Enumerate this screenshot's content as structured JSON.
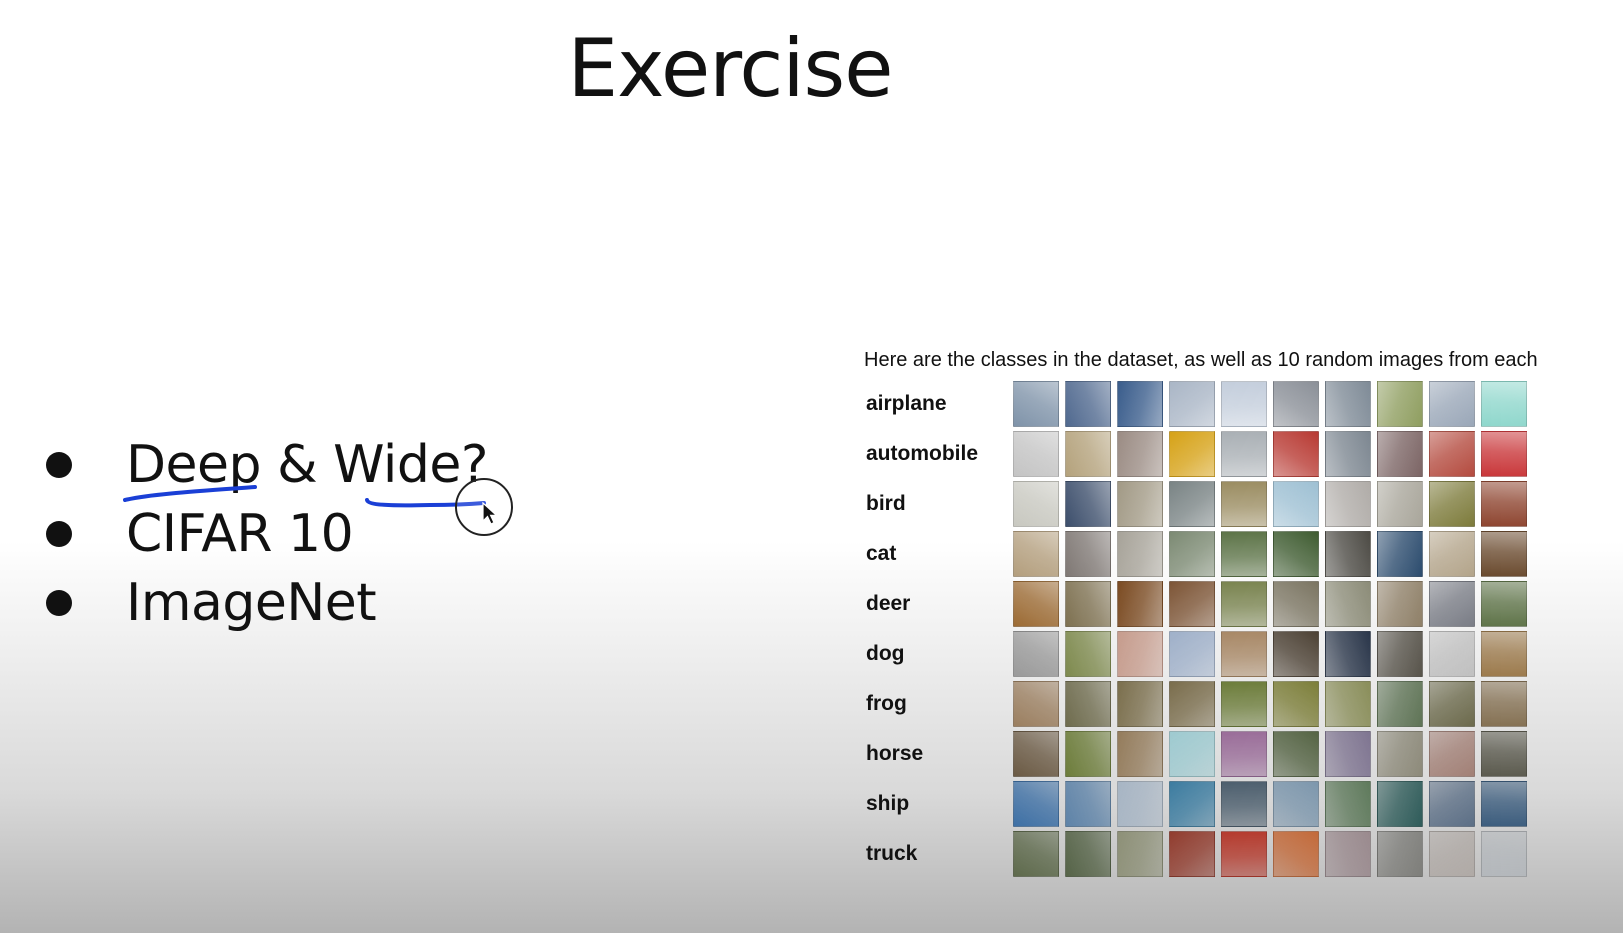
{
  "slide": {
    "title": "Exercise",
    "bullets": [
      {
        "text": "Deep & Wide?"
      },
      {
        "text": "CIFAR 10"
      },
      {
        "text": "ImageNet"
      }
    ]
  },
  "dataset": {
    "caption": "Here are the classes in the dataset, as well as 10 random images from each",
    "classes": [
      {
        "label": "airplane",
        "colors": [
          "#7f93a9",
          "#50698f",
          "#3a5d8c",
          "#aab6c6",
          "#c4cedc",
          "#8b9098",
          "#7f8b97",
          "#8f9e60",
          "#9aa7b8",
          "#8fd7cc"
        ]
      },
      {
        "label": "automobile",
        "colors": [
          "#c4c4c4",
          "#b4a27c",
          "#9b8c84",
          "#d6a217",
          "#aab0b5",
          "#b83a33",
          "#7d8791",
          "#7c6565",
          "#b44b3f",
          "#c9373a"
        ]
      },
      {
        "label": "bird",
        "colors": [
          "#c8c8c0",
          "#3d4f6c",
          "#a29a86",
          "#7a8485",
          "#9b8d62",
          "#9ec0d3",
          "#b0aca8",
          "#a9a69b",
          "#7d7b3b",
          "#8e4530"
        ]
      },
      {
        "label": "cat",
        "colors": [
          "#b39e7d",
          "#7f7874",
          "#a7a399",
          "#7c8a73",
          "#5d7448",
          "#3f5c31",
          "#4d4b45",
          "#2c4c6e",
          "#b3a48a",
          "#6a4a2e"
        ]
      },
      {
        "label": "deer",
        "colors": [
          "#9c6b34",
          "#7e7151",
          "#7b4b22",
          "#7d5536",
          "#7a8450",
          "#7b7562",
          "#8c8c78",
          "#8f8068",
          "#7a7d86",
          "#5f7449"
        ]
      },
      {
        "label": "dog",
        "colors": [
          "#9a9a9a",
          "#7e8a4e",
          "#c69c8d",
          "#9fb0c9",
          "#a88866",
          "#4d4235",
          "#2a364a",
          "#58544b",
          "#c0c0c0",
          "#9c7a4c"
        ]
      },
      {
        "label": "frog",
        "colors": [
          "#9b7f60",
          "#6f6c4e",
          "#7b6f4d",
          "#7a6d4c",
          "#6d7d3b",
          "#7d7f3a",
          "#8a8e5a",
          "#5f7456",
          "#6c6a4c",
          "#857153"
        ]
      },
      {
        "label": "horse",
        "colors": [
          "#6b5a44",
          "#6d7d3b",
          "#947c5c",
          "#9ecad0",
          "#9a6d99",
          "#556444",
          "#7f7591",
          "#8d8a7a",
          "#a28076",
          "#5b5a4e"
        ]
      },
      {
        "label": "ship",
        "colors": [
          "#3e70a5",
          "#5e83a8",
          "#a7b5c4",
          "#3c7ca0",
          "#4d5f6e",
          "#7d97ad",
          "#5f7a5c",
          "#2f5c5a",
          "#5c6f86",
          "#3c5d7e"
        ]
      },
      {
        "label": "truck",
        "colors": [
          "#5e6a4c",
          "#566448",
          "#8d9077",
          "#913c2e",
          "#b53b2e",
          "#c36a3a",
          "#9a8a8e",
          "#7e7e7a",
          "#b0aaa6",
          "#b4b8bc"
        ]
      }
    ]
  },
  "annotation": {
    "ink_color": "#1a3fd6",
    "cursor": "cursor-arrow-icon"
  }
}
